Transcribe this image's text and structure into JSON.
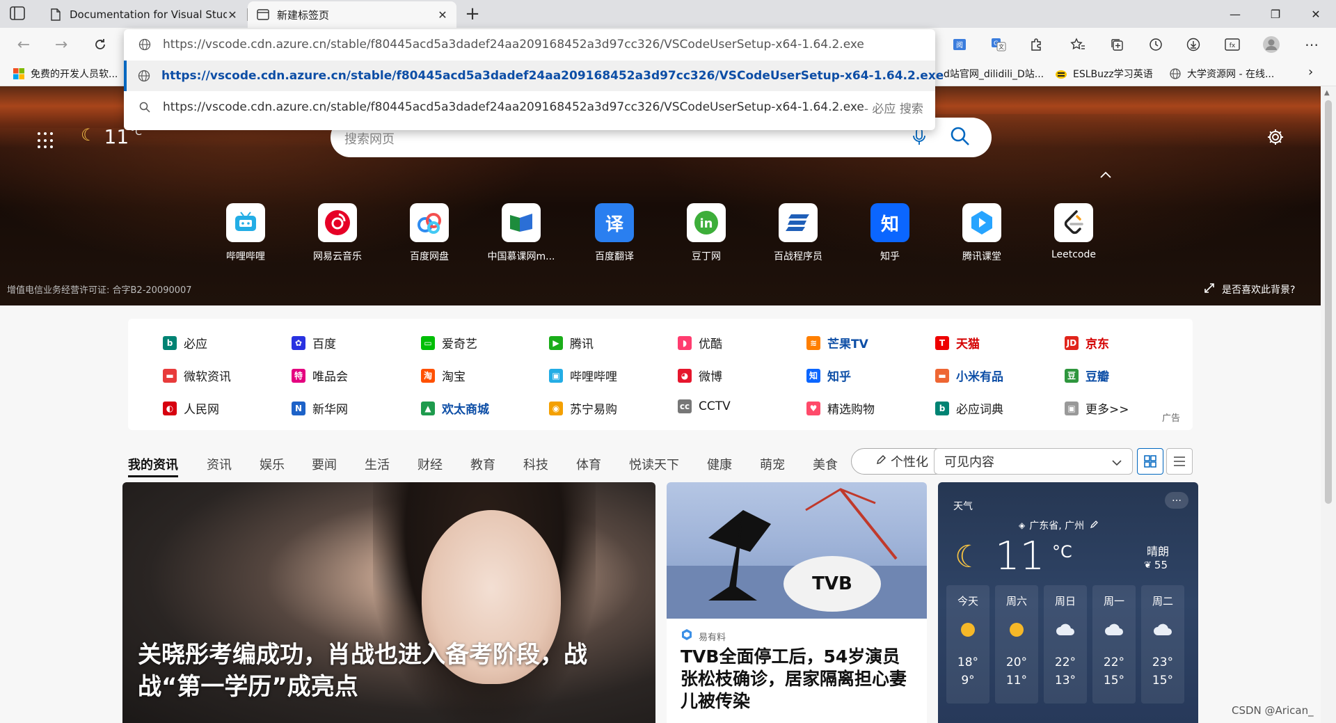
{
  "tabs": [
    {
      "title": "Documentation for Visual Studio Code",
      "icon": "page-icon",
      "active": false
    },
    {
      "title": "新建标签页",
      "icon": "newtab-icon",
      "active": true
    }
  ],
  "address": {
    "typed": "https://vscode.cdn.azure.cn/stable/f80445acd5a3dadef24aa209168452a3d97cc326/VSCodeUserSetup-x64-1.64.2.exe",
    "suggestions": [
      {
        "text": "https://vscode.cdn.azure.cn/stable/f80445acd5a3dadef24aa209168452a3d97cc326/VSCodeUserSetup-x64-1.64.2.exe",
        "suffix": "",
        "icon": "globe-icon"
      },
      {
        "text": "https://vscode.cdn.azure.cn/stable/f80445acd5a3dadef24aa209168452a3d97cc326/VSCodeUserSetup-x64-1.64.2.exe",
        "suffix": " - 必应 搜索",
        "icon": "search-icon"
      }
    ]
  },
  "favorites": [
    {
      "label": "免费的开发人员软...",
      "icon": "microsoft-icon"
    },
    {
      "label": "d站官网_dilidili_D站...",
      "icon": ""
    },
    {
      "label": "ESLBuzz学习英语",
      "icon": "bee-icon"
    },
    {
      "label": "大学资源网 - 在线...",
      "icon": "globe-icon"
    }
  ],
  "hero": {
    "weather_temp": "11",
    "weather_unit": "°C",
    "search_placeholder": "搜索网页",
    "license": "增值电信业务经营许可证: 合字B2-20090007",
    "like_bg": "是否喜欢此背景?",
    "tiles": [
      {
        "label": "哔哩哔哩",
        "color": "#23ade5",
        "glyph": "▣"
      },
      {
        "label": "网易云音乐",
        "color": "#e60026",
        "glyph": "◉"
      },
      {
        "label": "百度网盘",
        "color": "#2e8bf0",
        "glyph": "☁"
      },
      {
        "label": "中国慕课网m...",
        "color": "#1d8c3c",
        "glyph": "▰"
      },
      {
        "label": "百度翻译",
        "color": "#2a7ff0",
        "glyph": "译"
      },
      {
        "label": "豆丁网",
        "color": "#3dae3a",
        "glyph": "in"
      },
      {
        "label": "百战程序员",
        "color": "#1f5fb8",
        "glyph": "≡"
      },
      {
        "label": "知乎",
        "color": "#0b66ff",
        "glyph": "知"
      },
      {
        "label": "腾讯课堂",
        "color": "#27a4ff",
        "glyph": "◆"
      },
      {
        "label": "Leetcode",
        "color": "#f89f1b",
        "glyph": "ᑕ"
      }
    ]
  },
  "quick_links": [
    [
      {
        "label": "必应",
        "color": "#008373",
        "glyph": "b",
        "bold": false,
        "tc": "#1a1a1a"
      },
      {
        "label": "百度",
        "color": "#2932e1",
        "glyph": "✿",
        "bold": false,
        "tc": "#1a1a1a"
      },
      {
        "label": "爱奇艺",
        "color": "#00be06",
        "glyph": "▭",
        "bold": false,
        "tc": "#1a1a1a"
      },
      {
        "label": "腾讯",
        "color": "#1aad19",
        "glyph": "▶",
        "bold": false,
        "tc": "#1a1a1a"
      },
      {
        "label": "优酷",
        "color": "#ff3c6f",
        "glyph": "◗",
        "bold": false,
        "tc": "#1a1a1a"
      },
      {
        "label": "芒果TV",
        "color": "#ff7f00",
        "glyph": "≋",
        "bold": true,
        "tc": "#0d4ea6"
      },
      {
        "label": "天猫",
        "color": "#e00",
        "glyph": "T",
        "bold": true,
        "tc": "#d40000"
      },
      {
        "label": "京东",
        "color": "#e1251b",
        "glyph": "JD",
        "bold": true,
        "tc": "#d40000"
      }
    ],
    [
      {
        "label": "微软资讯",
        "color": "#e83b3b",
        "glyph": "▬",
        "bold": false,
        "tc": "#1a1a1a"
      },
      {
        "label": "唯品会",
        "color": "#e4007f",
        "glyph": "特",
        "bold": false,
        "tc": "#1a1a1a"
      },
      {
        "label": "淘宝",
        "color": "#ff5000",
        "glyph": "淘",
        "bold": false,
        "tc": "#1a1a1a"
      },
      {
        "label": "哔哩哔哩",
        "color": "#23ade5",
        "glyph": "▣",
        "bold": false,
        "tc": "#1a1a1a"
      },
      {
        "label": "微博",
        "color": "#e6162d",
        "glyph": "◕",
        "bold": false,
        "tc": "#1a1a1a"
      },
      {
        "label": "知乎",
        "color": "#0b66ff",
        "glyph": "知",
        "bold": true,
        "tc": "#0d4ea6"
      },
      {
        "label": "小米有品",
        "color": "#e63",
        "glyph": "▬",
        "bold": true,
        "tc": "#0d4ea6"
      },
      {
        "label": "豆瓣",
        "color": "#2e963d",
        "glyph": "豆",
        "bold": true,
        "tc": "#0d4ea6"
      }
    ],
    [
      {
        "label": "人民网",
        "color": "#d7000f",
        "glyph": "◐",
        "bold": false,
        "tc": "#1a1a1a"
      },
      {
        "label": "新华网",
        "color": "#1d62c8",
        "glyph": "N",
        "bold": false,
        "tc": "#1a1a1a"
      },
      {
        "label": "欢太商城",
        "color": "#1e9b4d",
        "glyph": "▲",
        "bold": true,
        "tc": "#0d4ea6"
      },
      {
        "label": "苏宁易购",
        "color": "#f4a000",
        "glyph": "◉",
        "bold": false,
        "tc": "#1a1a1a"
      },
      {
        "label": "CCTV",
        "color": "#777",
        "glyph": "cc",
        "bold": false,
        "tc": "#1a1a1a"
      },
      {
        "label": "精选购物",
        "color": "#ff4a6a",
        "glyph": "♥",
        "bold": false,
        "tc": "#1a1a1a"
      },
      {
        "label": "必应词典",
        "color": "#008373",
        "glyph": "b",
        "bold": false,
        "tc": "#1a1a1a"
      },
      {
        "label": "更多>>",
        "color": "#999",
        "glyph": "▣",
        "bold": false,
        "tc": "#1a1a1a"
      }
    ]
  ],
  "ad_label": "广告",
  "news_tabs": [
    "我的资讯",
    "资讯",
    "娱乐",
    "要闻",
    "生活",
    "财经",
    "教育",
    "科技",
    "体育",
    "悦读天下",
    "健康",
    "萌宠",
    "美食"
  ],
  "personalize_label": "个性化",
  "visible_content_label": "可见内容",
  "cards": {
    "main_title": "关晓彤考编成功，肖战也进入备考阶段，战战“第一学历”成亮点",
    "tvb_source": "易有料",
    "tvb_title": "TVB全面停工后，54岁演员张松枝确诊，居家隔离担心妻儿被传染",
    "tvb_logo": "TVB"
  },
  "weather_card": {
    "header": "天气",
    "location": "广东省, 广州",
    "temp": "11",
    "unit": "°C",
    "condition": "晴朗",
    "aqi": "55",
    "forecast": [
      {
        "day": "今天",
        "icon": "sun-icon",
        "hi": "18°",
        "lo": "9°"
      },
      {
        "day": "周六",
        "icon": "sun-icon",
        "hi": "20°",
        "lo": "11°"
      },
      {
        "day": "周日",
        "icon": "cloud-icon",
        "hi": "22°",
        "lo": "13°"
      },
      {
        "day": "周一",
        "icon": "cloud-icon",
        "hi": "22°",
        "lo": "15°"
      },
      {
        "day": "周二",
        "icon": "cloud-icon",
        "hi": "23°",
        "lo": "15°"
      }
    ]
  },
  "watermark": "CSDN @Arican_"
}
